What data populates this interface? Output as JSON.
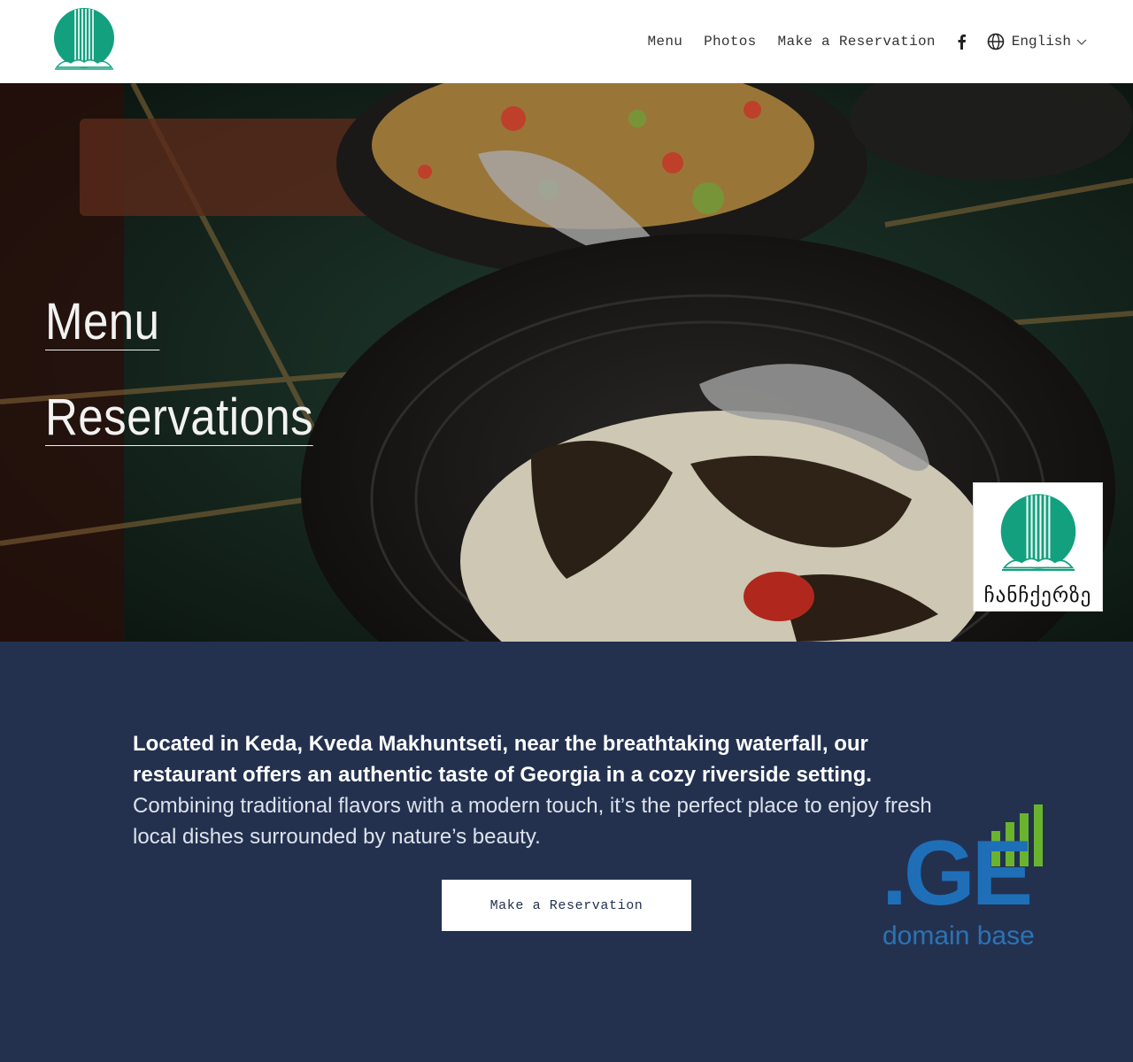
{
  "header": {
    "nav": [
      {
        "label": "Menu"
      },
      {
        "label": "Photos"
      },
      {
        "label": "Make a Reservation"
      }
    ],
    "social_icon": "facebook-icon",
    "language": {
      "icon": "globe-icon",
      "label": "English",
      "chevron": "chevron-down-icon"
    }
  },
  "hero": {
    "links": [
      {
        "label": "Menu"
      },
      {
        "label": "Reservations"
      }
    ],
    "badge_text": "ჩანჩქერზე"
  },
  "info": {
    "text_bold": "Located in Keda, Kveda Makhuntseti, near the breathtaking waterfall, our restaurant offers an authentic taste of Georgia in a cozy riverside setting.",
    "text_regular": " Combining traditional flavors with a modern touch, it’s the perfect place to enjoy fresh local dishes surrounded by nature’s beauty.",
    "cta_label": "Make a Reservation",
    "domain_logo": {
      "main": ".GE",
      "sub": "domain base"
    }
  },
  "colors": {
    "brand_green": "#13a07f",
    "section_navy": "#23314f",
    "domain_blue": "#1e6fb8",
    "domain_green": "#6ab42d"
  }
}
